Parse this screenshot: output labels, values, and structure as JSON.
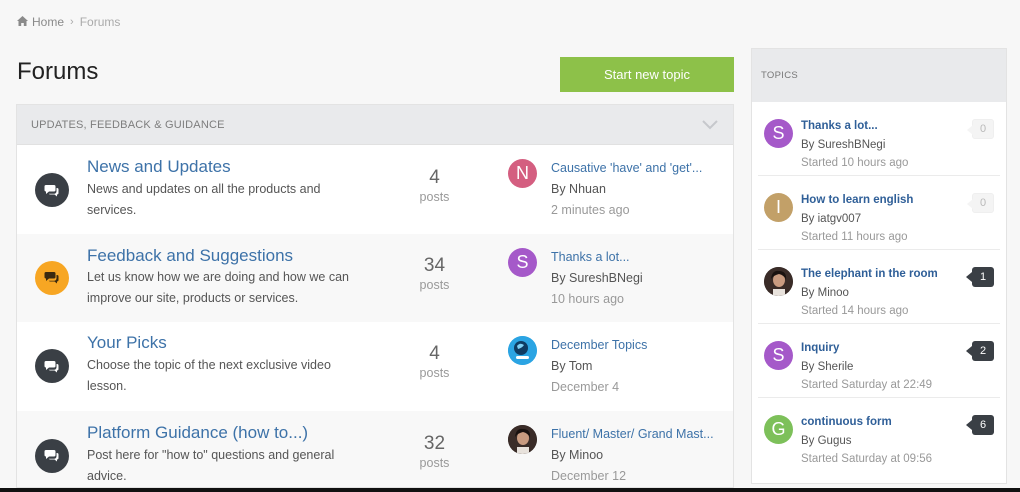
{
  "breadcrumb": {
    "home": "Home",
    "current": "Forums"
  },
  "page_title": "Forums",
  "start_button": "Start new topic",
  "category": {
    "title": "UPDATES, FEEDBACK & GUIDANCE"
  },
  "colors": {
    "accent_green": "#8dc149",
    "link_blue": "#3d72a8",
    "dark_icon": "#3a3f45",
    "orange_icon": "#f7a623"
  },
  "forums": [
    {
      "name": "News and Updates",
      "description": "News and updates on all the products and services.",
      "count": "4",
      "count_label": "posts",
      "icon": "chat-bubbles-icon",
      "last": {
        "avatar_letter": "N",
        "avatar_color": "#d45e80",
        "title": "Causative 'have' and 'get'...",
        "by": "By Nhuan",
        "time": "2 minutes ago"
      }
    },
    {
      "name": "Feedback and Suggestions",
      "description": "Let us know how we are doing and how we can improve our site, products or services.",
      "count": "34",
      "count_label": "posts",
      "icon": "chat-bubbles-icon",
      "last": {
        "avatar_letter": "S",
        "avatar_color": "#a559c9",
        "title": "Thanks a lot...",
        "by": "By SureshBNegi",
        "time": "10 hours ago"
      }
    },
    {
      "name": "Your Picks",
      "description": "Choose the topic of the next exclusive video lesson.",
      "count": "4",
      "count_label": "posts",
      "icon": "chat-bubbles-icon",
      "last": {
        "avatar_letter": "",
        "avatar_color": "#29a3e0",
        "title": "December Topics",
        "by": "By Tom",
        "time": "December 4"
      }
    },
    {
      "name": "Platform Guidance (how to...)",
      "description": "Post here for \"how to\" questions and general advice.",
      "count": "32",
      "count_label": "posts",
      "icon": "chat-bubbles-icon",
      "last": {
        "avatar_letter": "",
        "avatar_color": "#2b2220",
        "title": "Fluent/ Master/ Grand Mast...",
        "by": "By Minoo",
        "time": "December 12"
      }
    }
  ],
  "topics": {
    "title": "TOPICS",
    "items": [
      {
        "avatar_letter": "S",
        "avatar_color": "#a559c9",
        "title": "Thanks a lot...",
        "by": "By SureshBNegi",
        "time": "Started 10 hours ago",
        "replies": "0"
      },
      {
        "avatar_letter": "I",
        "avatar_color": "#c2a068",
        "title": "How to learn english",
        "by": "By iatgv007",
        "time": "Started 11 hours ago",
        "replies": "0"
      },
      {
        "avatar_letter": "",
        "avatar_color": "#2b2220",
        "title": "The elephant in the room",
        "by": "By Minoo",
        "time": "Started 14 hours ago",
        "replies": "1"
      },
      {
        "avatar_letter": "S",
        "avatar_color": "#a559c9",
        "title": "Inquiry",
        "by": "By Sherile",
        "time": "Started Saturday at 22:49",
        "replies": "2"
      },
      {
        "avatar_letter": "G",
        "avatar_color": "#7dc05a",
        "title": "continuous form",
        "by": "By Gugus",
        "time": "Started Saturday at 09:56",
        "replies": "6"
      }
    ]
  }
}
